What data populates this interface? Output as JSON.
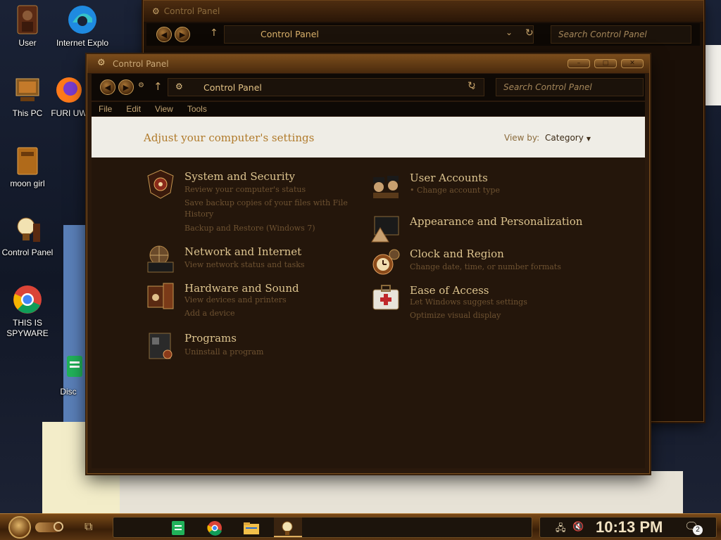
{
  "desktop": {
    "icons": [
      {
        "label": "User",
        "icon": "user-portrait-icon"
      },
      {
        "label": "Internet Explo",
        "icon": "edge-browser-icon"
      },
      {
        "label": "This PC",
        "icon": "computer-icon"
      },
      {
        "label": "FURI UW",
        "icon": "firefox-icon"
      },
      {
        "label": "moon girl",
        "icon": "folder-icon"
      },
      {
        "label": "Control Panel",
        "icon": "control-panel-lightbulb-icon"
      },
      {
        "label": "THIS IS SPYWARE",
        "icon": "chrome-icon"
      },
      {
        "label": "Disc",
        "icon": "app-shortcut-icon"
      }
    ]
  },
  "back_window": {
    "title": "Control Panel",
    "breadcrumb": "Control Panel",
    "search_placeholder": "Search Control Panel"
  },
  "window": {
    "title": "Control Panel",
    "breadcrumb": "Control Panel",
    "search_placeholder": "Search Control Panel",
    "menu": [
      "File",
      "Edit",
      "View",
      "Tools"
    ],
    "header": "Adjust your computer's settings",
    "view_by_label": "View by:",
    "view_by_value": "Category",
    "categories_left": [
      {
        "title": "System and Security",
        "icon": "shield-gear-icon",
        "links": [
          "Review your computer's status",
          "Save backup copies of your files with File",
          "History",
          "Backup and Restore (Windows 7)"
        ]
      },
      {
        "title": "Network and Internet",
        "icon": "globe-network-icon",
        "links": [
          "View network status and tasks"
        ]
      },
      {
        "title": "Hardware and Sound",
        "icon": "printer-speaker-icon",
        "links": [
          "View devices and printers",
          "Add a device"
        ]
      },
      {
        "title": "Programs",
        "icon": "programs-box-icon",
        "links": [
          "Uninstall a program"
        ]
      }
    ],
    "categories_right": [
      {
        "title": "User Accounts",
        "icon": "user-accounts-icon",
        "links": [
          "Change account type"
        ]
      },
      {
        "title": "Appearance and Personalization",
        "icon": "monitor-fan-icon",
        "links": []
      },
      {
        "title": "Clock and Region",
        "icon": "clock-globe-icon",
        "links": [
          "Change date, time, or number formats"
        ]
      },
      {
        "title": "Ease of Access",
        "icon": "first-aid-case-icon",
        "links": [
          "Let Windows suggest settings",
          "Optimize visual display"
        ]
      }
    ]
  },
  "taskbar": {
    "time": "10:13 PM",
    "notification_count": "2",
    "pinned": [
      "docs-app-icon",
      "chrome-icon",
      "file-explorer-icon",
      "control-panel-icon"
    ]
  },
  "colors": {
    "accent_gold": "#ddc48f",
    "link_brown": "#6e5231",
    "window_bg": "#24160b",
    "header_strip": "#efede6"
  }
}
